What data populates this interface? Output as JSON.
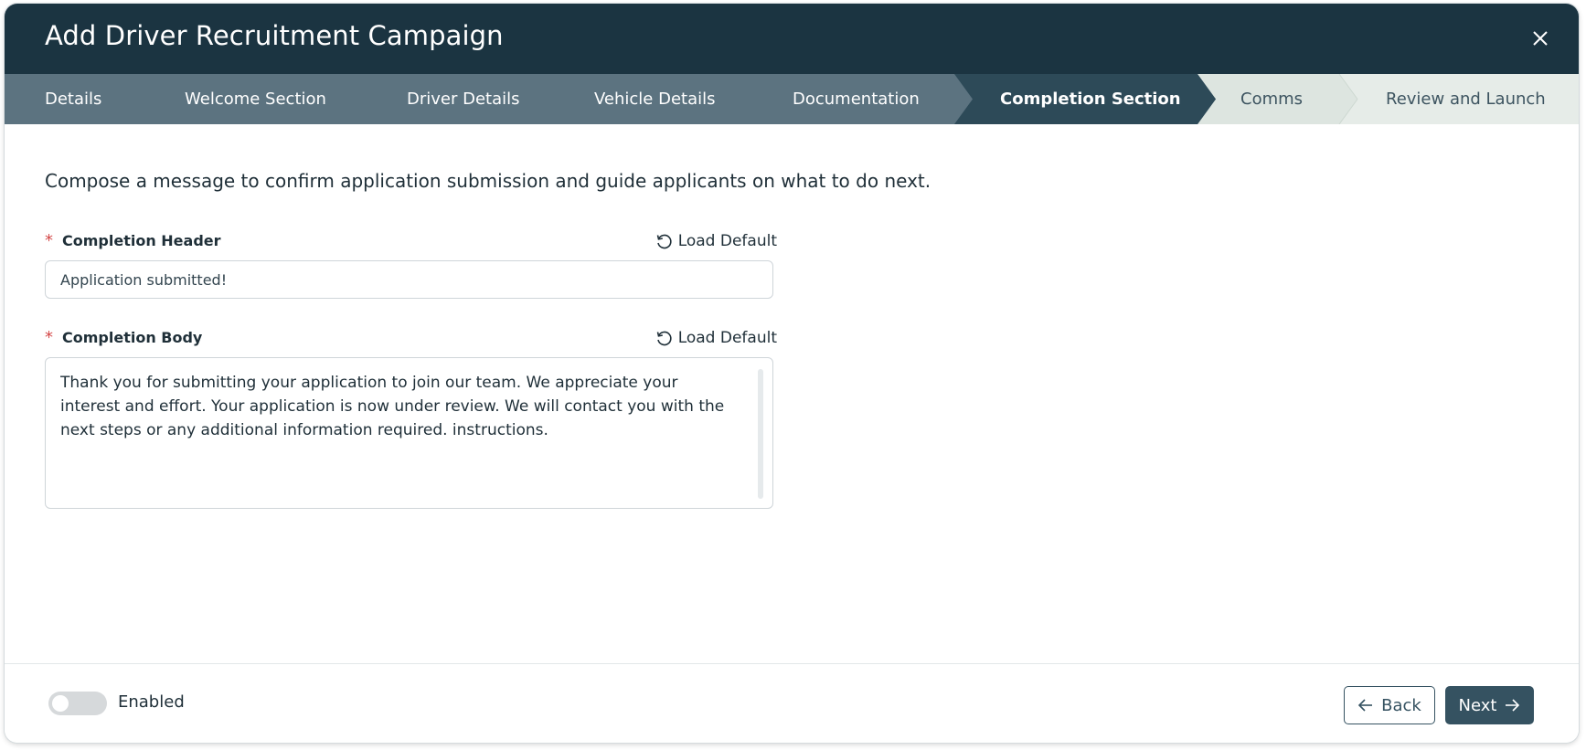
{
  "dialog": {
    "title": "Add Driver Recruitment Campaign"
  },
  "steps": [
    {
      "label": "Details",
      "state": "done"
    },
    {
      "label": "Welcome Section",
      "state": "done"
    },
    {
      "label": "Driver Details",
      "state": "done"
    },
    {
      "label": "Vehicle Details",
      "state": "done"
    },
    {
      "label": "Documentation",
      "state": "done"
    },
    {
      "label": "Completion Section",
      "state": "active"
    },
    {
      "label": "Comms",
      "state": "todo"
    },
    {
      "label": "Review and Launch",
      "state": "todo"
    }
  ],
  "intro": "Compose a message to confirm application submission and guide applicants on what to do next.",
  "form": {
    "header_field": {
      "required_mark": "*",
      "label": "Completion Header",
      "load_default": "Load Default",
      "value": "Application submitted!"
    },
    "body_field": {
      "required_mark": "*",
      "label": "Completion Body",
      "load_default": "Load Default",
      "value": "Thank you for submitting your application to join our team. We appreciate your interest and effort. Your application is now under review. We will contact you with the next steps or any additional information required. instructions."
    }
  },
  "footer": {
    "toggle_label": "Enabled",
    "toggle_on": false,
    "back_label": "Back",
    "next_label": "Next"
  },
  "colors": {
    "header_bg": "#1b3441",
    "step_done": "#5c7380",
    "step_active": "#2d4a58",
    "step_todo": "#dde5e0",
    "accent": "#355261"
  }
}
